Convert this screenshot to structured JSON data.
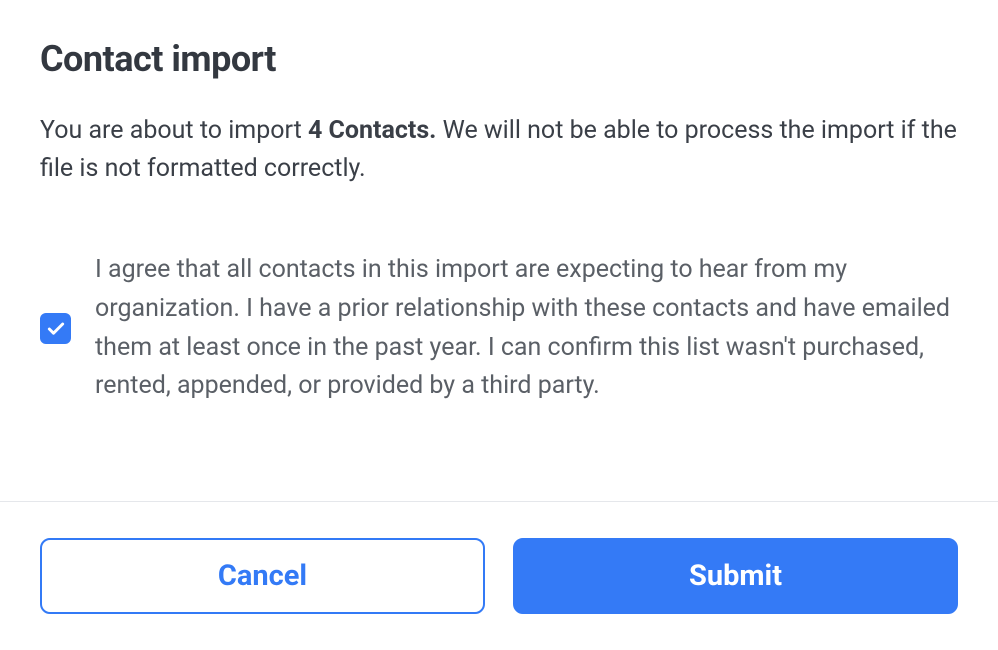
{
  "dialog": {
    "title": "Contact import",
    "description": {
      "prefix": "You are about to import ",
      "strong": "4 Contacts.",
      "suffix": " We will not be able to process the import if the file is not formatted correctly."
    },
    "consent": {
      "checked": true,
      "text": "I agree that all contacts in this import are expecting to hear from my organization. I have a prior relationship with these contacts and have emailed them at least once in the past year. I can confirm this list wasn't purchased, rented, appended, or provided by a third party."
    },
    "footer": {
      "cancel_label": "Cancel",
      "submit_label": "Submit"
    }
  }
}
